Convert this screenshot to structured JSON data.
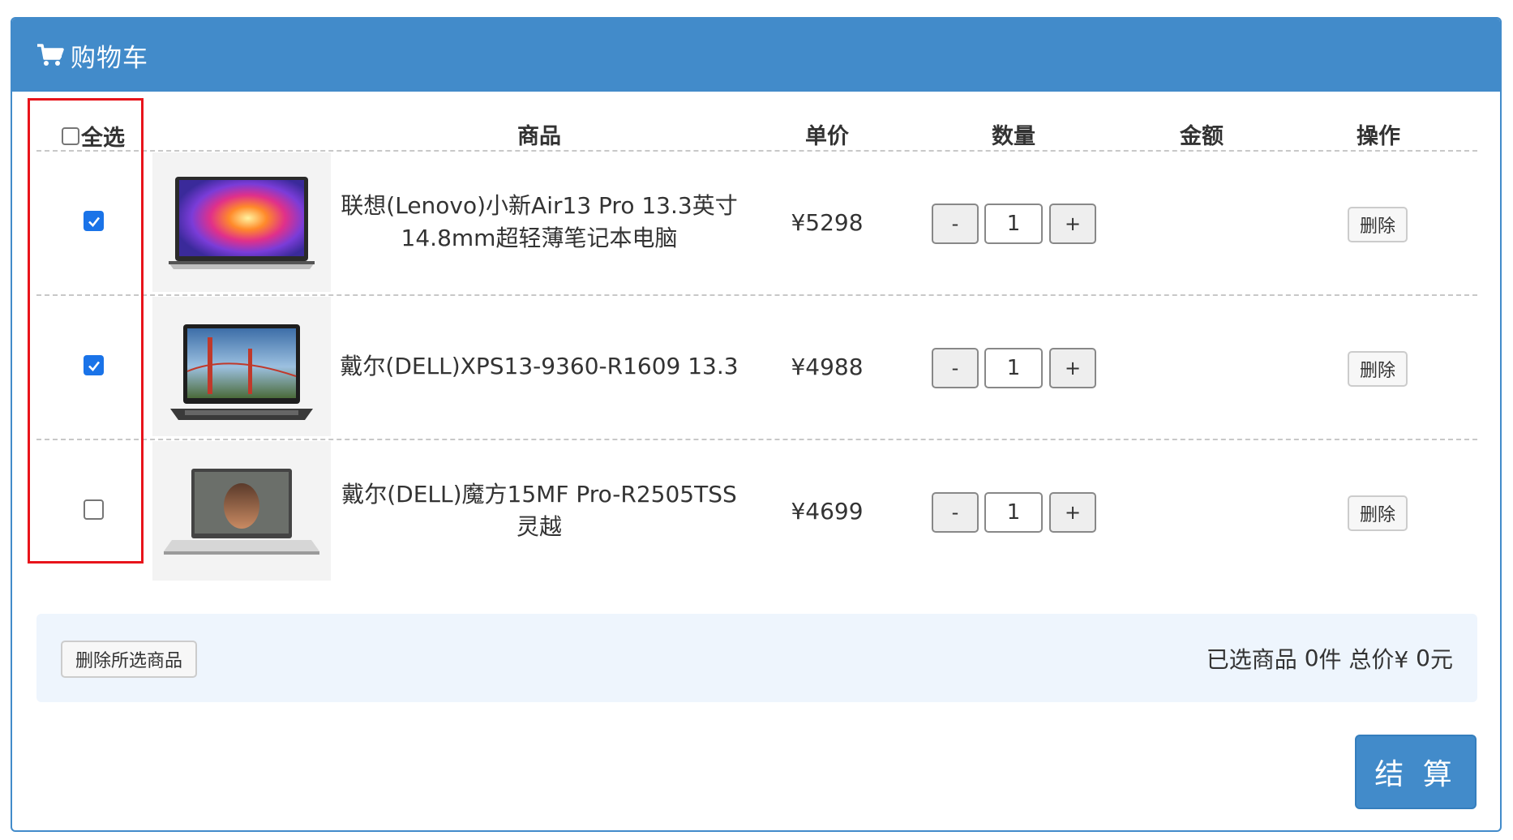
{
  "header": {
    "title": "购物车",
    "icon": "shopping-cart-icon"
  },
  "table": {
    "select_all_label": "全选",
    "columns": {
      "product": "商品",
      "unit_price": "单价",
      "quantity": "数量",
      "amount": "金额",
      "action": "操作"
    },
    "rows": [
      {
        "checked": true,
        "name": "联想(Lenovo)小新Air13 Pro 13.3英寸14.8mm超轻薄笔记本电脑",
        "price": "¥5298",
        "quantity": "1",
        "amount": "",
        "minus": "-",
        "plus": "+",
        "delete": "删除"
      },
      {
        "checked": true,
        "name": "戴尔(DELL)XPS13-9360-R1609 13.3",
        "price": "¥4988",
        "quantity": "1",
        "amount": "",
        "minus": "-",
        "plus": "+",
        "delete": "删除"
      },
      {
        "checked": false,
        "name": "戴尔(DELL)魔方15MF Pro-R2505TSS灵越",
        "price": "¥4699",
        "quantity": "1",
        "amount": "",
        "minus": "-",
        "plus": "+",
        "delete": "删除"
      }
    ]
  },
  "summary": {
    "delete_selected_label": "删除所选商品",
    "selected_prefix": "已选商品 ",
    "selected_count": "0",
    "count_unit": "件",
    "total_prefix": " 总价¥ ",
    "total_value": "0",
    "currency_unit": "元"
  },
  "checkout_label": "结 算",
  "colors": {
    "primary": "#428bca",
    "highlight_border": "#e8141b",
    "summary_bg": "#eef5fd",
    "checkbox_checked": "#1a73e8"
  }
}
